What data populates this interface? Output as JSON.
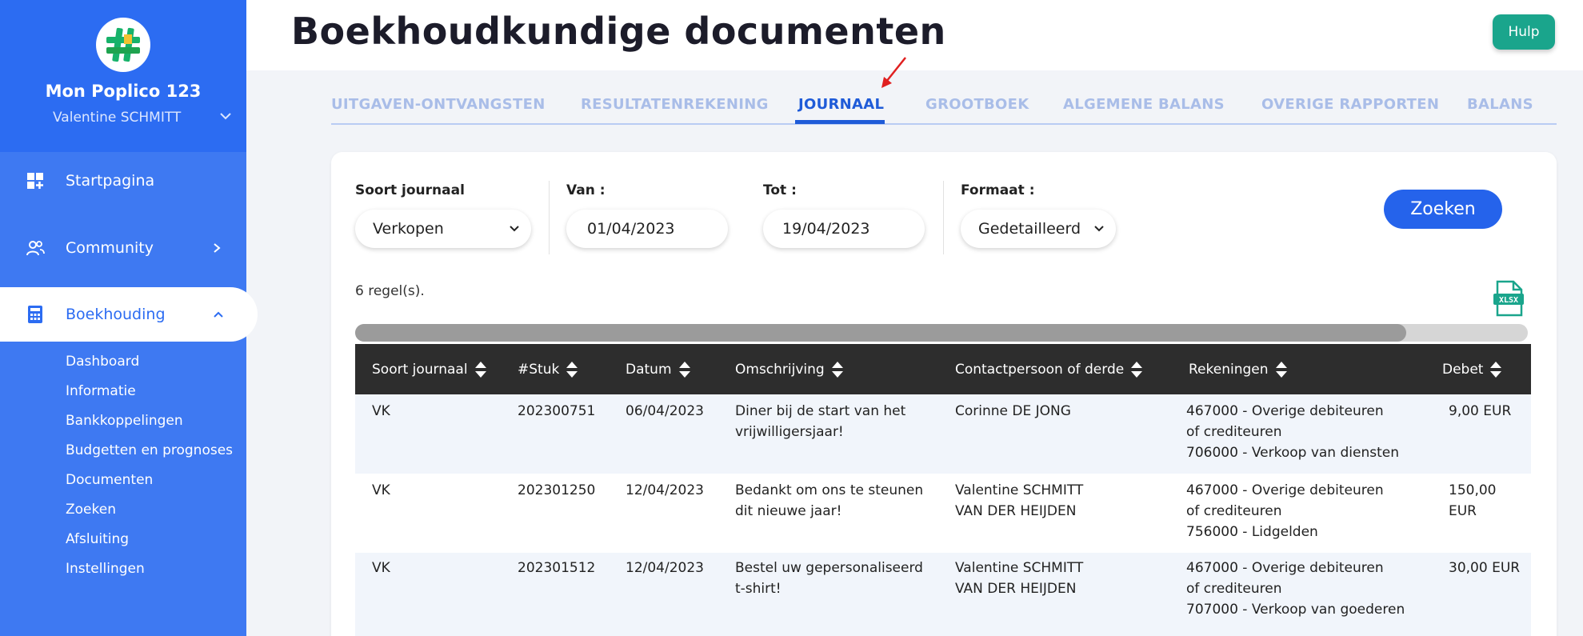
{
  "sidebar": {
    "org_name": "Mon Poplico 123",
    "user_name": "Valentine SCHMITT",
    "nav": [
      {
        "label": "Startpagina",
        "icon": "dashboard-plus-icon"
      },
      {
        "label": "Community",
        "icon": "users-icon"
      },
      {
        "label": "Boekhouding",
        "icon": "calculator-icon"
      }
    ],
    "sub_items": [
      "Dashboard",
      "Informatie",
      "Bankkoppelingen",
      "Budgetten en prognoses",
      "Documenten",
      "Zoeken",
      "Afsluiting",
      "Instellingen"
    ]
  },
  "header": {
    "title": "Boekhoudkundige documenten",
    "help_label": "Hulp"
  },
  "tabs": [
    "UITGAVEN-ONTVANGSTEN",
    "RESULTATENREKENING",
    "JOURNAAL",
    "GROOTBOEK",
    "ALGEMENE BALANS",
    "OVERIGE RAPPORTEN",
    "BALANS"
  ],
  "active_tab": "JOURNAAL",
  "filters": {
    "journal_label": "Soort journaal",
    "journal_value": "Verkopen",
    "from_label": "Van :",
    "from_value": "01/04/2023",
    "to_label": "Tot :",
    "to_value": "19/04/2023",
    "format_label": "Formaat :",
    "format_value": "Gedetailleerd",
    "search_label": "Zoeken"
  },
  "results": {
    "row_count": "6 regel(s).",
    "export_label": "XLSX"
  },
  "table": {
    "columns": [
      "Soort journaal",
      "#Stuk",
      "Datum",
      "Omschrijving",
      "Contactpersoon of derde",
      "Rekeningen",
      "Debet"
    ],
    "rows": [
      {
        "journal": "VK",
        "piece": "202300751",
        "date": "06/04/2023",
        "description_1": "Diner bij de start van het",
        "description_2": "vrijwilligersjaar!",
        "contact_1": "Corinne DE JONG",
        "contact_2": "",
        "account_1": "467000 - Overige debiteuren",
        "account_2": "of crediteuren",
        "account_3": "706000 - Verkoop van diensten",
        "debit_1": "9,00 EUR",
        "debit_2": ""
      },
      {
        "journal": "VK",
        "piece": "202301250",
        "date": "12/04/2023",
        "description_1": "Bedankt om ons te steunen",
        "description_2": "dit nieuwe jaar!",
        "contact_1": "Valentine SCHMITT",
        "contact_2": "VAN DER HEIJDEN",
        "account_1": "467000 - Overige debiteuren",
        "account_2": "of crediteuren",
        "account_3": "756000 - Lidgelden",
        "debit_1": "150,00",
        "debit_2": "EUR"
      },
      {
        "journal": "VK",
        "piece": "202301512",
        "date": "12/04/2023",
        "description_1": "Bestel uw gepersonaliseerd",
        "description_2": "t-shirt!",
        "contact_1": "Valentine SCHMITT",
        "contact_2": "VAN DER HEIJDEN",
        "account_1": "467000 - Overige debiteuren",
        "account_2": "of crediteuren",
        "account_3": "707000 - Verkoop van goederen",
        "debit_1": "30,00 EUR",
        "debit_2": ""
      }
    ]
  },
  "colors": {
    "sidebar": "#3e79f2",
    "sidebar_header": "#2c6cf2",
    "accent": "#1f5bd8",
    "help": "#1aa58c",
    "table_header": "#2d2d2d"
  }
}
